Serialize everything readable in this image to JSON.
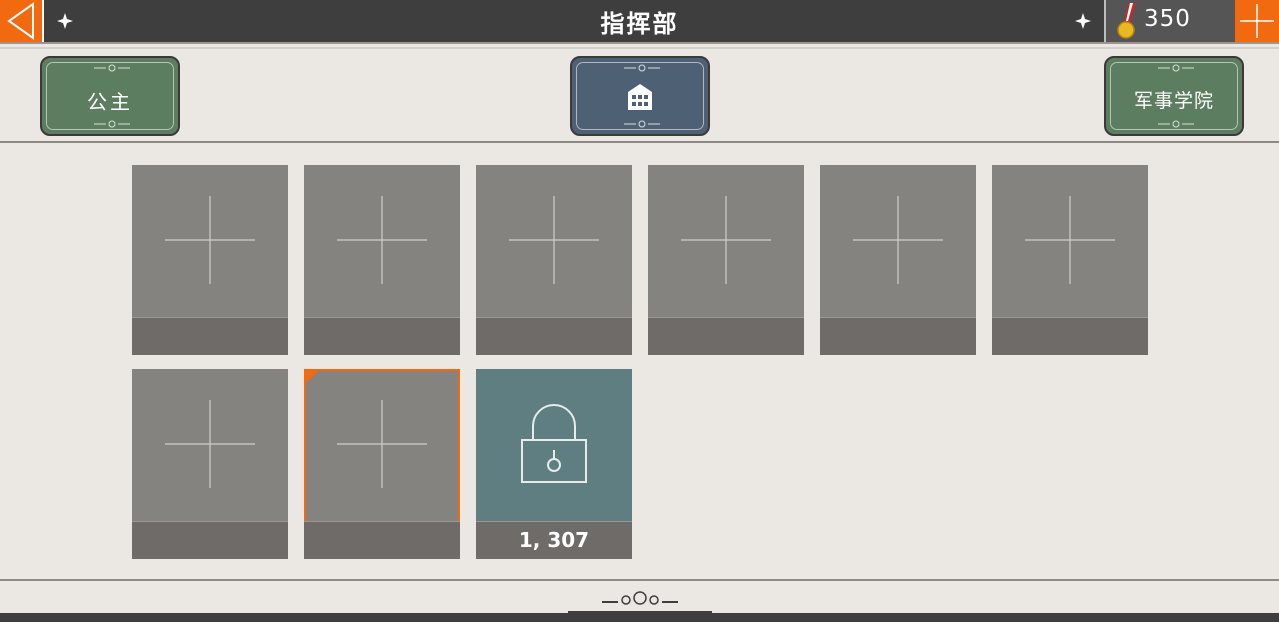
{
  "header": {
    "title": "指挥部",
    "currency_value": "350",
    "currency_icon": "medal-icon"
  },
  "tabs": [
    {
      "label": "公主",
      "color": "#5c7d5f"
    },
    {
      "label": "",
      "icon": "building-icon",
      "color": "#4e6074",
      "active": true
    },
    {
      "label": "军事学院",
      "color": "#5c7d5f"
    }
  ],
  "slots": {
    "row1": [
      "empty",
      "empty",
      "empty",
      "empty",
      "empty",
      "empty"
    ],
    "row2": [
      "empty",
      "empty-selected"
    ],
    "locked": {
      "cost": "1, 307",
      "icon": "lock-icon"
    }
  },
  "colors": {
    "accent": "#f26a10",
    "topbar": "#3e3e3e",
    "slot": "#858380",
    "locked_slot": "#5f7e82"
  }
}
